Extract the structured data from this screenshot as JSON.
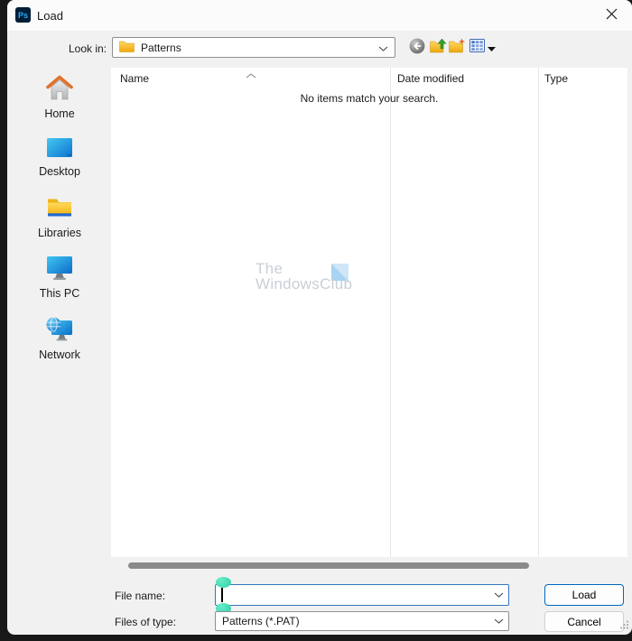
{
  "window": {
    "app_badge": "Ps",
    "title": "Load"
  },
  "address_bar": {
    "look_in_label": "Look in:",
    "location": "Patterns"
  },
  "toolbar": {
    "icons": [
      {
        "name": "back-icon",
        "meaning": "go to last folder visited"
      },
      {
        "name": "up-one-level-icon",
        "meaning": "up one level"
      },
      {
        "name": "new-folder-icon",
        "meaning": "create new folder"
      },
      {
        "name": "view-menu-icon",
        "meaning": "view menu"
      }
    ]
  },
  "sidebar": {
    "items": [
      {
        "label": "Home",
        "icon": "home-icon"
      },
      {
        "label": "Desktop",
        "icon": "desktop-icon"
      },
      {
        "label": "Libraries",
        "icon": "libraries-icon"
      },
      {
        "label": "This PC",
        "icon": "this-pc-icon"
      },
      {
        "label": "Network",
        "icon": "network-icon"
      }
    ]
  },
  "file_list": {
    "columns": [
      {
        "label": "Name"
      },
      {
        "label": "Date modified"
      },
      {
        "label": "Type"
      }
    ],
    "sorted_by": "Name",
    "empty_message": "No items match your search.",
    "watermark": {
      "line1": "The",
      "line2": "WindowsClub"
    }
  },
  "footer": {
    "file_name_label": "File name:",
    "file_name_value": "",
    "files_of_type_label": "Files of type:",
    "files_of_type_value": "Patterns (*.PAT)",
    "load_button": "Load",
    "cancel_button": "Cancel"
  },
  "colors": {
    "accent_blue": "#0067c0",
    "focus_border": "#3576bd",
    "selection_handle_teal": "#3eddb2",
    "folder_yellow": "#f5b60d",
    "dialog_bg": "#f1f1f1",
    "titlebar_bg": "#fbfbfb",
    "backdrop": "#181818",
    "scrollbar_thumb": "#8a8a8a",
    "watermark_text": "#c9cfd7",
    "ps_badge_bg": "#001e36",
    "ps_badge_text": "#31a8ff"
  }
}
